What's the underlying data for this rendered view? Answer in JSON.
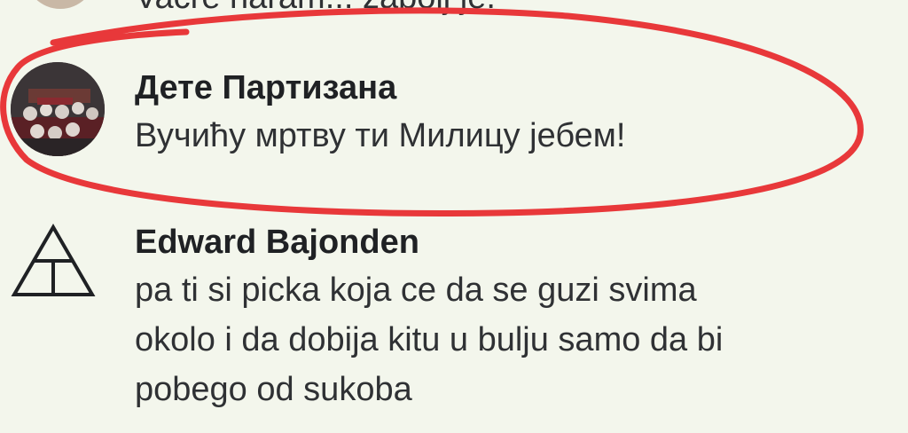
{
  "comments": [
    {
      "partial_text": "Vacre haram... zabolj je.",
      "avatar_icon": "user-avatar-icon"
    },
    {
      "author": "Дете Партизана",
      "text": "Вучићу мртву ти Милицу јебем!",
      "avatar_icon": "group-photo-avatar-icon",
      "highlighted": true
    },
    {
      "author": "Edward Bajonden",
      "text_lines": [
        "pa ti si picka koja ce da se guzi svima",
        "okolo i da dobija kitu u bulju samo da bi",
        "pobego od sukoba"
      ],
      "avatar_icon": "triangle-t-logo-icon"
    }
  ],
  "colors": {
    "background": "#f3f6ec",
    "highlight": "#e8383a",
    "text": "#2f3134"
  }
}
